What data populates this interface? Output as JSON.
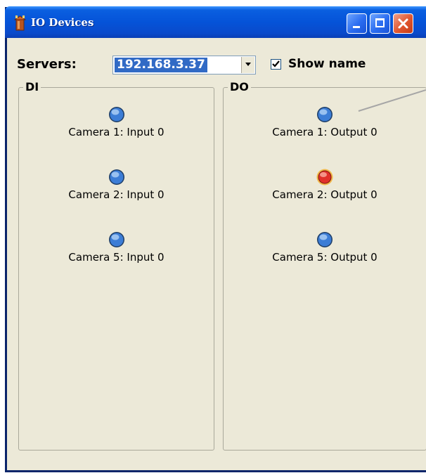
{
  "window": {
    "title": "IO Devices",
    "controls": [
      "minimize",
      "maximize",
      "close"
    ]
  },
  "toolbar": {
    "servers_label": "Servers:",
    "server_selected": "192.168.3.37",
    "show_name_checked": true,
    "show_name_label": "Show name"
  },
  "di": {
    "title": "DI",
    "items": [
      {
        "label": "Camera 1: Input 0",
        "state": "off"
      },
      {
        "label": "Camera 2: Input 0",
        "state": "off"
      },
      {
        "label": "Camera 5: Input 0",
        "state": "off"
      }
    ]
  },
  "do": {
    "title": "DO",
    "items": [
      {
        "label": "Camera 1: Output 0",
        "state": "off"
      },
      {
        "label": "Camera 2: Output 0",
        "state": "on"
      },
      {
        "label": "Camera 5: Output 0",
        "state": "off"
      }
    ]
  },
  "colors": {
    "led_off": "#2F6FC8",
    "led_on": "#E0302A",
    "led_on_ring": "#F2B84A",
    "window_bg": "#ECE9D8",
    "titlebar": "#0553D8",
    "selection": "#316AC5"
  }
}
